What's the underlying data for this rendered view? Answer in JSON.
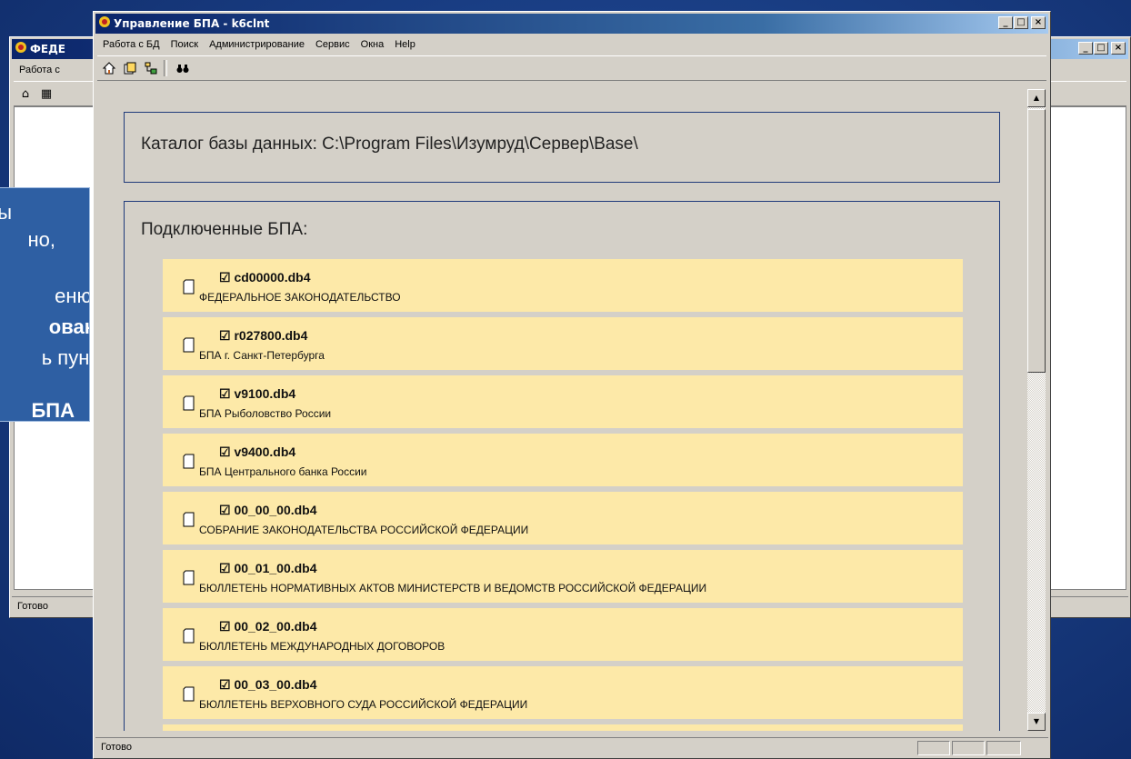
{
  "back_window": {
    "title": "ФЕДЕ",
    "menu_label": "Работа с",
    "status": "Готово"
  },
  "callout": {
    "lines": [
      "ы",
      "но,",
      "еню",
      "ован",
      "ь пунк",
      "БПА"
    ]
  },
  "main_window": {
    "title": "Управление БПА - k6clnt",
    "menu": [
      "Работа с БД",
      "Поиск",
      "Администрирование",
      "Сервис",
      "Окна",
      "Help"
    ],
    "toolbar": [
      "home-icon",
      "database-icon",
      "tree-icon",
      "binoculars-icon"
    ],
    "catalog_text": "Каталог базы данных: C:\\Program Files\\Изумруд\\Сервер\\Base\\",
    "connected_title": "Подключенные БПА:",
    "items": [
      {
        "file": "cd00000.db4",
        "desc": "ФЕДЕРАЛЬНОЕ ЗАКОНОДАТЕЛЬСТВО"
      },
      {
        "file": "r027800.db4",
        "desc": "БПА г. Санкт-Петербурга"
      },
      {
        "file": "v9100.db4",
        "desc": "БПА Рыболовство России"
      },
      {
        "file": "v9400.db4",
        "desc": "БПА Центрального банка России"
      },
      {
        "file": "00_00_00.db4",
        "desc": "СОБРАНИЕ ЗАКОНОДАТЕЛЬСТВА РОССИЙСКОЙ ФЕДЕРАЦИИ"
      },
      {
        "file": "00_01_00.db4",
        "desc": "БЮЛЛЕТЕНЬ НОРМАТИВНЫХ АКТОВ МИНИСТЕРСТВ И ВЕДОМСТВ РОССИЙСКОЙ ФЕДЕРАЦИИ"
      },
      {
        "file": "00_02_00.db4",
        "desc": "БЮЛЛЕТЕНЬ МЕЖДУНАРОДНЫХ ДОГОВОРОВ"
      },
      {
        "file": "00_03_00.db4",
        "desc": "БЮЛЛЕТЕНЬ ВЕРХОВНОГО СУДА РОССИЙСКОЙ ФЕДЕРАЦИИ"
      }
    ],
    "status": "Готово"
  }
}
